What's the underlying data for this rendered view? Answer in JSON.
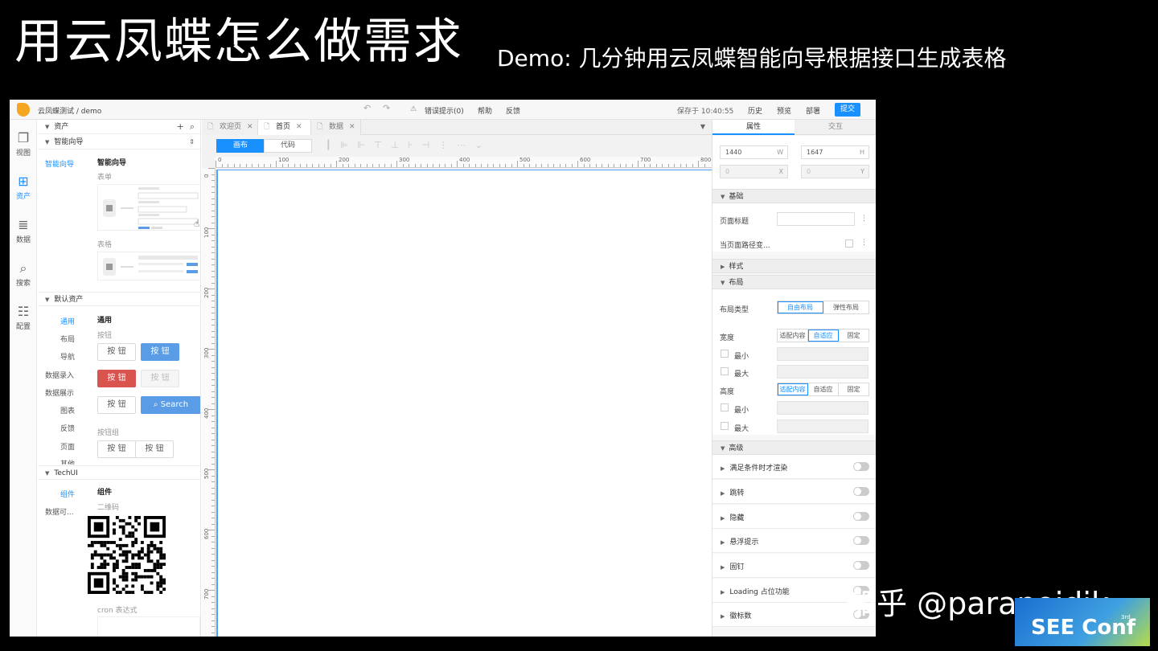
{
  "slide": {
    "title": "用云凤蝶怎么做需求",
    "subtitle": "Demo: 几分钟用云凤蝶智能向导根据接口生成表格",
    "watermark": "知乎 @paranoidjk",
    "conf_logo": "SEE Conf",
    "conf_edition": "3rd"
  },
  "app": {
    "breadcrumb": "云凤蝶测试  /  demo",
    "toolbar": {
      "undo_icon": "undo-icon",
      "redo_icon": "redo-icon",
      "errors": "错误提示(0)",
      "help": "帮助",
      "feedback": "反馈",
      "saved": "保存于 10:40:55",
      "history": "历史",
      "preview": "预览",
      "deploy": "部署",
      "submit": "提交"
    },
    "rail": [
      {
        "label": "视图",
        "icon": "copy-icon"
      },
      {
        "label": "资产",
        "icon": "plus-square-icon"
      },
      {
        "label": "数据",
        "icon": "database-icon"
      },
      {
        "label": "搜索",
        "icon": "search-icon"
      },
      {
        "label": "配置",
        "icon": "sliders-icon"
      }
    ],
    "left_panel": {
      "header": "资产",
      "wizard_section": "智能向导",
      "wizard_category": "智能向导",
      "wizard_group": "智能向导",
      "wizard_form": "表单",
      "wizard_table": "表格",
      "default_section": "默认资产",
      "default_categories": [
        "通用",
        "布局",
        "导航",
        "数据录入",
        "数据展示",
        "图表",
        "反馈",
        "页面",
        "其他"
      ],
      "general_group": "通用",
      "buttons_label": "按钮",
      "button_text": "按 钮",
      "search_text": "Search",
      "button_group_label": "按钮组",
      "techui_section": "TechUI",
      "techui_categories": [
        "组件",
        "数据可..."
      ],
      "component_group": "组件",
      "qr_label": "二维码",
      "cron_label": "cron 表达式"
    },
    "tabs": [
      {
        "label": "欢迎页",
        "active": false
      },
      {
        "label": "首页",
        "active": true
      },
      {
        "label": "数据",
        "active": false
      }
    ],
    "mode_canvas": "画布",
    "mode_code": "代码",
    "ruler_h": [
      "0",
      "100",
      "200",
      "300",
      "400",
      "500",
      "600",
      "700",
      "800"
    ],
    "ruler_v": [
      "0",
      "100",
      "200",
      "300",
      "400",
      "500",
      "600",
      "700"
    ],
    "right_panel": {
      "tab_props": "属性",
      "tab_interact": "交互",
      "width": "1440",
      "width_unit": "W",
      "height": "1647",
      "height_unit": "H",
      "x": "0",
      "x_unit": "X",
      "y": "0",
      "y_unit": "Y",
      "basic": "基础",
      "page_title_label": "页面标题",
      "page_path_label": "当页面路径变...",
      "style": "样式",
      "layout": "布局",
      "layout_type_label": "布局类型",
      "layout_free": "自由布局",
      "layout_flex": "弹性布局",
      "width_label": "宽度",
      "height_label": "高度",
      "size_fit": "适配内容",
      "size_auto": "自适应",
      "size_fixed": "固定",
      "min_label": "最小",
      "max_label": "最大",
      "advanced": "高级",
      "advanced_items": [
        "满足条件时才渲染",
        "跳转",
        "隐藏",
        "悬浮提示",
        "固钉",
        "Loading 占位功能",
        "徽标数"
      ]
    }
  }
}
